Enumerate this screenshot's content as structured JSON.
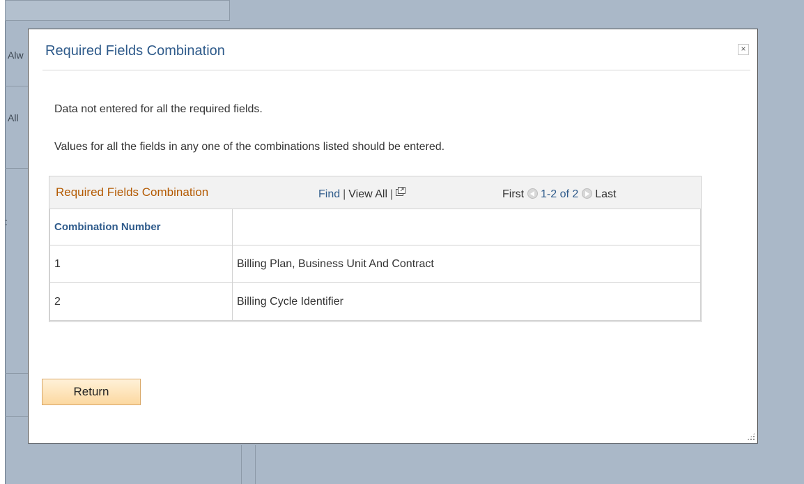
{
  "background": {
    "fragments": [
      "Alw",
      "All",
      ":"
    ]
  },
  "dialog": {
    "title": "Required Fields Combination",
    "close_label": "×",
    "message_1": "Data not entered for all the required fields.",
    "message_2": "Values for all the fields in any one of the combinations listed should be entered.",
    "grid": {
      "title": "Required Fields Combination",
      "nav": {
        "find": "Find",
        "view_all": "View All",
        "popout_icon": "new-window-icon",
        "first": "First",
        "range": "1-2 of 2",
        "last": "Last"
      },
      "columns": [
        "Combination Number",
        ""
      ],
      "rows": [
        [
          "1",
          "Billing Plan, Business Unit And Contract"
        ],
        [
          "2",
          "Billing Cycle Identifier"
        ]
      ]
    },
    "return_label": "Return"
  },
  "colors": {
    "title_blue": "#2f5b8b",
    "grid_title_orange": "#b35900",
    "button_gradient": [
      "#fff1d8",
      "#fcd8a0"
    ]
  }
}
